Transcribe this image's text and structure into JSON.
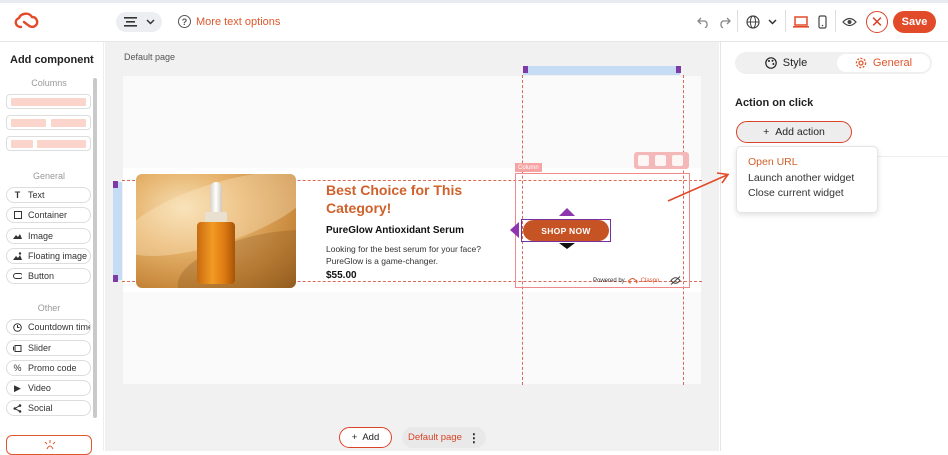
{
  "topbar": {
    "more_text_options": "More text options",
    "save_label": "Save"
  },
  "sidebar": {
    "title": "Add component",
    "columns_label": "Columns",
    "general_label": "General",
    "other_label": "Other",
    "general_items": [
      "Text",
      "Container",
      "Image",
      "Floating image",
      "Button"
    ],
    "other_items": [
      "Countdown timer",
      "Slider",
      "Promo code",
      "Video",
      "Social"
    ]
  },
  "canvas": {
    "page_label": "Default page",
    "column_tag": "Column",
    "product": {
      "title": "Best Choice for This Category!",
      "subtitle": "PureGlow Antioxidant Serum",
      "description": "Looking for the best serum for your face? PureGlow is a game-changer.",
      "price": "$55.00",
      "button": "SHOP NOW"
    },
    "powered_by": "Powered by",
    "brand": "Claspo"
  },
  "bottombar": {
    "add_label": "Add",
    "page_pill": "Default page"
  },
  "right_panel": {
    "tabs": [
      "Style",
      "General"
    ],
    "active_tab": "General",
    "action_title": "Action on click",
    "add_action_label": "Add action",
    "dropdown_items": [
      "Open URL",
      "Launch another widget",
      "Close current widget"
    ]
  },
  "colors": {
    "accent": "#e24b2a",
    "title_orange": "#d0612b",
    "selection_purple": "#8e36b0",
    "guide_blue": "#c6dcf5"
  },
  "icons": {
    "align": "align-center-icon",
    "help": "question-circle-icon",
    "undo": "undo-icon",
    "redo": "redo-icon",
    "language": "globe-icon",
    "desktop": "laptop-icon",
    "mobile": "phone-icon",
    "preview": "eye-icon",
    "close": "close-icon"
  }
}
